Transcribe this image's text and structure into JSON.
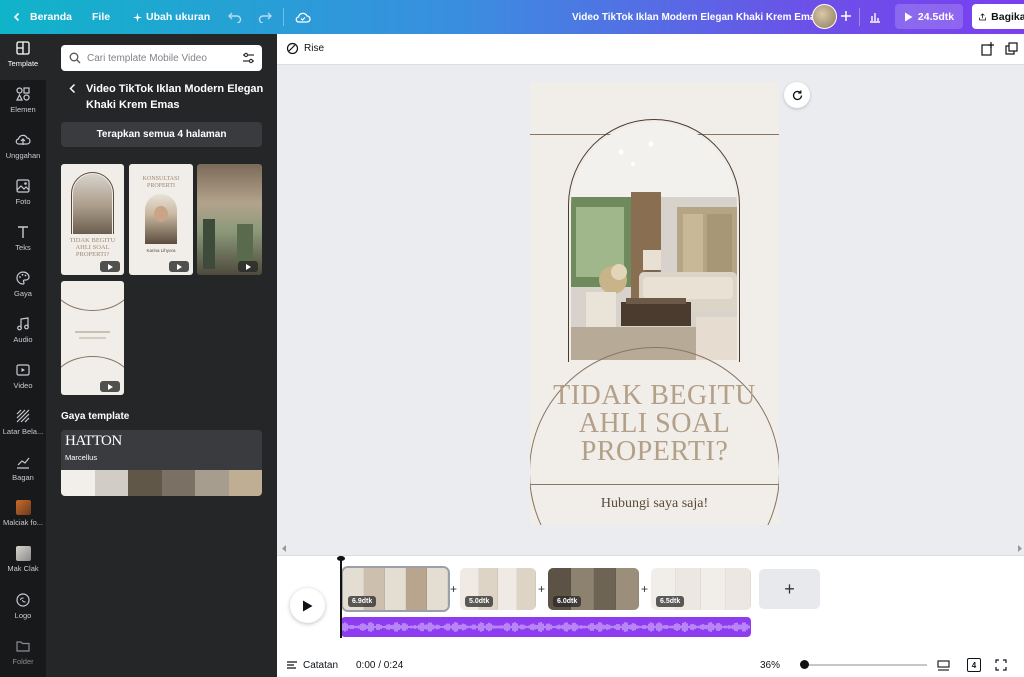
{
  "topbar": {
    "home_label": "Beranda",
    "file_label": "File",
    "resize_label": "Ubah ukuran",
    "doc_title": "Video TikTok Iklan Modern Elegan Khaki Krem Emas",
    "duration_label": "24.5dtk",
    "share_label": "Bagikan"
  },
  "rail": {
    "items": [
      {
        "label": "Template",
        "icon": "template-icon"
      },
      {
        "label": "Elemen",
        "icon": "elements-icon"
      },
      {
        "label": "Unggahan",
        "icon": "upload-icon"
      },
      {
        "label": "Foto",
        "icon": "photo-icon"
      },
      {
        "label": "Teks",
        "icon": "text-icon"
      },
      {
        "label": "Gaya",
        "icon": "palette-icon"
      },
      {
        "label": "Audio",
        "icon": "audio-icon"
      },
      {
        "label": "Video",
        "icon": "video-icon"
      },
      {
        "label": "Latar Bela...",
        "icon": "background-icon"
      },
      {
        "label": "Bagan",
        "icon": "chart-icon"
      },
      {
        "label": "Malciak fo...",
        "icon": "folder-thumb"
      },
      {
        "label": "Mak Clak",
        "icon": "folder-thumb"
      },
      {
        "label": "Logo",
        "icon": "logo-icon"
      },
      {
        "label": "Folder",
        "icon": "folder-icon"
      }
    ]
  },
  "panel": {
    "search_placeholder": "Cari template Mobile Video",
    "template_title": "Video TikTok Iklan Modern Elegan Khaki Krem Emas",
    "apply_all_label": "Terapkan semua 4 halaman",
    "style_section_label": "Gaya template",
    "style_font_name": "HATTON",
    "style_font_sub": "Marcellus",
    "swatches": [
      "#f2efea",
      "#d1ccc5",
      "#605748",
      "#7a7164",
      "#a69d8e",
      "#bfae93"
    ],
    "thumb1_text": "TIDAK BEGITU AHLI SOAL PROPERTI?",
    "thumb2_title": "KONSULTASI PROPERTI",
    "thumb2_name": "Karina Lihyora"
  },
  "editor": {
    "animation_label": "Rise",
    "headline": "TIDAK BEGITU AHLI SOAL PROPERTI?",
    "subline": "Hubungi saya saja!"
  },
  "timeline": {
    "clips": [
      {
        "duration": "6.9dtk"
      },
      {
        "duration": "5.0dtk"
      },
      {
        "duration": "6.0dtk"
      },
      {
        "duration": "6.5dtk"
      }
    ],
    "add_page_label": "+"
  },
  "status": {
    "notes_label": "Catatan",
    "time_label": "0:00 / 0:24",
    "zoom_label": "36%",
    "page_count": "4"
  },
  "colors": {
    "accent_gradient_start": "#10b4c9",
    "accent_gradient_end": "#7a3ff0",
    "audio_track": "#8d3cf0",
    "headline_text": "#b3a089"
  }
}
